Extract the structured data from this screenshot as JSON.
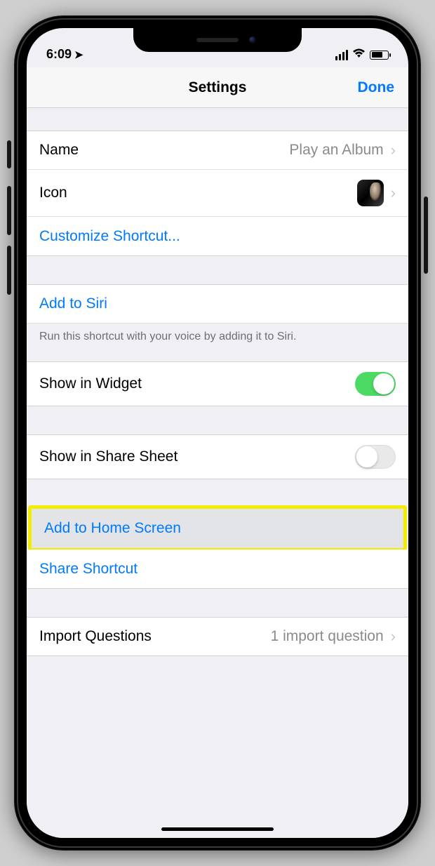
{
  "status": {
    "time": "6:09",
    "location_icon": "➤"
  },
  "nav": {
    "title": "Settings",
    "done": "Done"
  },
  "rows": {
    "name_label": "Name",
    "name_value": "Play an Album",
    "icon_label": "Icon",
    "customize": "Customize Shortcut...",
    "add_to_siri": "Add to Siri",
    "siri_footer": "Run this shortcut with your voice by adding it to Siri.",
    "show_widget": "Show in Widget",
    "show_widget_on": true,
    "show_share": "Show in Share Sheet",
    "show_share_on": false,
    "add_home": "Add to Home Screen",
    "share_shortcut": "Share Shortcut",
    "import_label": "Import Questions",
    "import_value": "1 import question"
  }
}
